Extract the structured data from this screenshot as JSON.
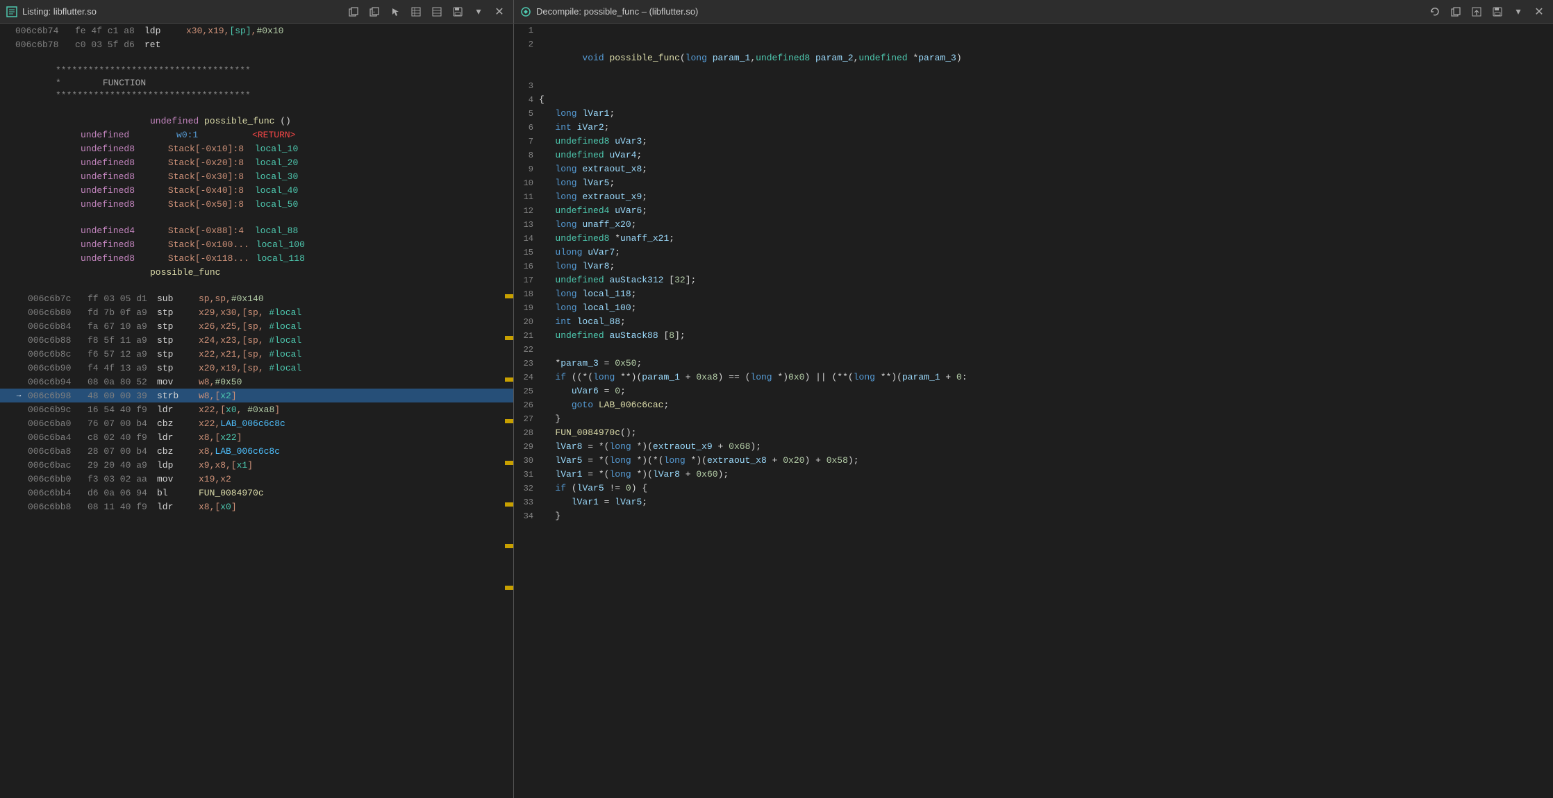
{
  "leftPanel": {
    "title": "Listing: libflutter.so",
    "lines": [
      {
        "addr": "006c6b74",
        "bytes": "fe 4f c1 a8",
        "mnemonic": "ldp",
        "operands": "x30,x19,[sp],#0x10",
        "highlight": false,
        "arrow": false
      },
      {
        "addr": "006c6b78",
        "bytes": "c0 03 5f d6",
        "mnemonic": "ret",
        "operands": "",
        "highlight": false,
        "arrow": false
      },
      {
        "type": "spacer"
      },
      {
        "type": "separator",
        "text": "************************************"
      },
      {
        "type": "separator",
        "text": "*                          FUNCTION"
      },
      {
        "type": "separator",
        "text": "************************************"
      },
      {
        "type": "spacer"
      },
      {
        "type": "funcdef",
        "text": "undefined possible_func()"
      },
      {
        "type": "param",
        "typeName": "undefined",
        "reg": "w0:1",
        "label": "<RETURN>"
      },
      {
        "type": "stackvar",
        "typeName": "undefined8",
        "stack": "Stack[-0x10]:8",
        "name": "local_10"
      },
      {
        "type": "stackvar",
        "typeName": "undefined8",
        "stack": "Stack[-0x20]:8",
        "name": "local_20"
      },
      {
        "type": "stackvar",
        "typeName": "undefined8",
        "stack": "Stack[-0x30]:8",
        "name": "local_30"
      },
      {
        "type": "stackvar",
        "typeName": "undefined8",
        "stack": "Stack[-0x40]:8",
        "name": "local_40"
      },
      {
        "type": "stackvar",
        "typeName": "undefined8",
        "stack": "Stack[-0x50]:8",
        "name": "local_50"
      },
      {
        "type": "spacer"
      },
      {
        "type": "stackvar",
        "typeName": "undefined4",
        "stack": "Stack[-0x88]:4",
        "name": "local_88"
      },
      {
        "type": "stackvar",
        "typeName": "undefined8",
        "stack": "Stack[-0x100...",
        "name": "local_100"
      },
      {
        "type": "stackvar",
        "typeName": "undefined8",
        "stack": "Stack[-0x118...",
        "name": "local_118"
      },
      {
        "type": "funclabel",
        "text": "possible_func"
      },
      {
        "type": "spacer"
      },
      {
        "addr": "006c6b7c",
        "bytes": "ff 03 05 d1",
        "mnemonic": "sub",
        "operands": "sp,sp,#0x140",
        "highlight": false,
        "arrow": false
      },
      {
        "addr": "006c6b80",
        "bytes": "fd 7b 0f a9",
        "mnemonic": "stp",
        "operands": "x29,x30,[sp, #local",
        "highlight": false,
        "arrow": false
      },
      {
        "addr": "006c6b84",
        "bytes": "fa 67 10 a9",
        "mnemonic": "stp",
        "operands": "x26,x25,[sp, #local",
        "highlight": false,
        "arrow": false
      },
      {
        "addr": "006c6b88",
        "bytes": "f8 5f 11 a9",
        "mnemonic": "stp",
        "operands": "x24,x23,[sp, #local",
        "highlight": false,
        "arrow": false
      },
      {
        "addr": "006c6b8c",
        "bytes": "f6 57 12 a9",
        "mnemonic": "stp",
        "operands": "x22,x21,[sp, #local",
        "highlight": false,
        "arrow": false
      },
      {
        "addr": "006c6b90",
        "bytes": "f4 4f 13 a9",
        "mnemonic": "stp",
        "operands": "x20,x19,[sp, #local",
        "highlight": false,
        "arrow": false
      },
      {
        "addr": "006c6b94",
        "bytes": "08 0a 80 52",
        "mnemonic": "mov",
        "operands": "w8,#0x50",
        "highlight": false,
        "arrow": false
      },
      {
        "addr": "006c6b98",
        "bytes": "48 00 00 39",
        "mnemonic": "strb",
        "operands": "w8,[x2]",
        "highlight": true,
        "arrow": true
      },
      {
        "addr": "006c6b9c",
        "bytes": "16 54 40 f9",
        "mnemonic": "ldr",
        "operands": "x22,[x0, #0xa8]",
        "highlight": false,
        "arrow": false
      },
      {
        "addr": "006c6ba0",
        "bytes": "76 07 00 b4",
        "mnemonic": "cbz",
        "operands": "x22,LAB_006c6c8c",
        "highlight": false,
        "arrow": false
      },
      {
        "addr": "006c6ba4",
        "bytes": "c8 02 40 f9",
        "mnemonic": "ldr",
        "operands": "x8,[x22]",
        "highlight": false,
        "arrow": false
      },
      {
        "addr": "006c6ba8",
        "bytes": "28 07 00 b4",
        "mnemonic": "cbz",
        "operands": "x8,LAB_006c6c8c",
        "highlight": false,
        "arrow": false
      },
      {
        "addr": "006c6bac",
        "bytes": "29 20 40 a9",
        "mnemonic": "ldp",
        "operands": "x9,x8,[x1]",
        "highlight": false,
        "arrow": false
      },
      {
        "addr": "006c6bb0",
        "bytes": "f3 03 02 aa",
        "mnemonic": "mov",
        "operands": "x19,x2",
        "highlight": false,
        "arrow": false
      },
      {
        "addr": "006c6bb4",
        "bytes": "d6 0a 06 94",
        "mnemonic": "bl",
        "operands": "FUN_0084970c",
        "highlight": false,
        "arrow": false
      },
      {
        "addr": "006c6bb8",
        "bytes": "08 11 40 f9",
        "mnemonic": "ldr",
        "operands": "x8,[x0]",
        "highlight": false,
        "arrow": false
      }
    ]
  },
  "rightPanel": {
    "title": "Decompile: possible_func – (libflutter.so)",
    "lines": [
      {
        "num": 1,
        "content": ""
      },
      {
        "num": 2,
        "content": "void possible_func(long param_1,undefined8 param_2,undefined *param_3)"
      },
      {
        "num": 3,
        "content": ""
      },
      {
        "num": 4,
        "content": "{"
      },
      {
        "num": 5,
        "content": "   long lVar1;"
      },
      {
        "num": 6,
        "content": "   int iVar2;"
      },
      {
        "num": 7,
        "content": "   undefined8 uVar3;"
      },
      {
        "num": 8,
        "content": "   undefined uVar4;"
      },
      {
        "num": 9,
        "content": "   long extraout_x8;"
      },
      {
        "num": 10,
        "content": "   long lVar5;"
      },
      {
        "num": 11,
        "content": "   long extraout_x9;"
      },
      {
        "num": 12,
        "content": "   undefined4 uVar6;"
      },
      {
        "num": 13,
        "content": "   long unaff_x20;"
      },
      {
        "num": 14,
        "content": "   undefined8 *unaff_x21;"
      },
      {
        "num": 15,
        "content": "   ulong uVar7;"
      },
      {
        "num": 16,
        "content": "   long lVar8;"
      },
      {
        "num": 17,
        "content": "   undefined auStack312 [32];"
      },
      {
        "num": 18,
        "content": "   long local_118;"
      },
      {
        "num": 19,
        "content": "   long local_100;"
      },
      {
        "num": 20,
        "content": "   int local_88;"
      },
      {
        "num": 21,
        "content": "   undefined auStack88 [8];"
      },
      {
        "num": 22,
        "content": ""
      },
      {
        "num": 23,
        "content": "   *param_3 = 0x50;"
      },
      {
        "num": 24,
        "content": "   if ((*( long **)(param_1 + 0xa8) == (long *)0x0) || (**( long **)(param_1 + 0:"
      },
      {
        "num": 25,
        "content": "      uVar6 = 0;"
      },
      {
        "num": 26,
        "content": "      goto LAB_006c6cac;"
      },
      {
        "num": 27,
        "content": "   }"
      },
      {
        "num": 28,
        "content": "   FUN_0084970c();"
      },
      {
        "num": 29,
        "content": "   lVar8 = *( long *)(extraout_x9 + 0x68);"
      },
      {
        "num": 30,
        "content": "   lVar5 = *( long *)(*( long *)(extraout_x8 + 0x20) + 0x58);"
      },
      {
        "num": 31,
        "content": "   lVar1 = *( long *)(lVar8 + 0x60);"
      },
      {
        "num": 32,
        "content": "   if (lVar5 != 0) {"
      },
      {
        "num": 33,
        "content": "      lVar1 = lVar5;"
      },
      {
        "num": 34,
        "content": "   }"
      }
    ]
  },
  "toolbar": {
    "leftTitle": "Listing: libflutter.so",
    "rightTitle": "Decompile: possible_func – (libflutter.so)",
    "closeLabel": "✕"
  },
  "icons": {
    "listing": "📋",
    "decompile": "⚙",
    "copy": "⧉",
    "cursor": "↖",
    "grid1": "⊞",
    "grid2": "⊟",
    "save": "💾",
    "dropdown": "▾",
    "refresh": "↻",
    "export": "⬆",
    "more": "≡"
  }
}
